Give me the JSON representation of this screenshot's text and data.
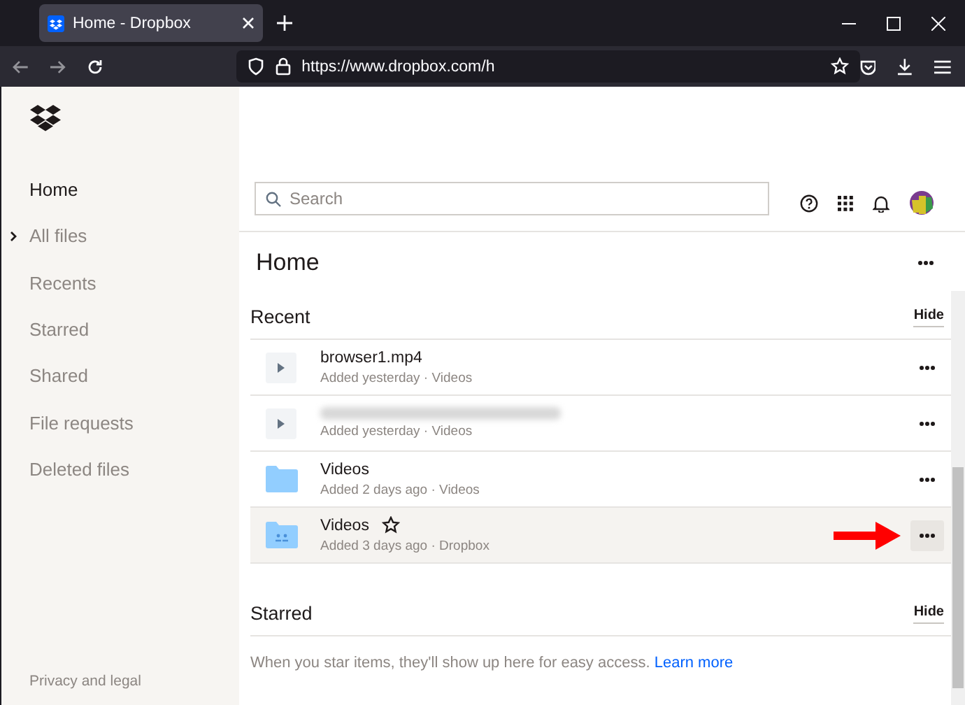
{
  "browser": {
    "tab_title": "Home - Dropbox",
    "url": "https://www.dropbox.com/h"
  },
  "sidebar": {
    "items": [
      {
        "label": "Home",
        "selected": true,
        "collapsed": false
      },
      {
        "label": "All files",
        "selected": false,
        "collapsed": true
      },
      {
        "label": "Recents",
        "selected": false,
        "collapsed": false
      },
      {
        "label": "Starred",
        "selected": false,
        "collapsed": false
      },
      {
        "label": "Shared",
        "selected": false,
        "collapsed": false
      },
      {
        "label": "File requests",
        "selected": false,
        "collapsed": false
      },
      {
        "label": "Deleted files",
        "selected": false,
        "collapsed": false
      }
    ],
    "footer": "Privacy and legal"
  },
  "search": {
    "placeholder": "Search"
  },
  "page_title": "Home",
  "recent": {
    "title": "Recent",
    "hide": "Hide",
    "items": [
      {
        "kind": "video",
        "name": "browser1.mp4",
        "blurred": false,
        "meta": "Added yesterday · Videos",
        "hovered": false
      },
      {
        "kind": "video",
        "blurred": true,
        "meta": "Added yesterday · Videos",
        "hovered": false
      },
      {
        "kind": "folder",
        "name": "Videos",
        "blurred": false,
        "meta": "Added 2 days ago · Videos",
        "hovered": false
      },
      {
        "kind": "shared-folder",
        "name": "Videos",
        "blurred": false,
        "meta": "Added 3 days ago · Dropbox",
        "hovered": true
      }
    ]
  },
  "starred": {
    "title": "Starred",
    "hide": "Hide",
    "message": "When you star items, they'll show up here for easy access.",
    "link": "Learn more"
  }
}
